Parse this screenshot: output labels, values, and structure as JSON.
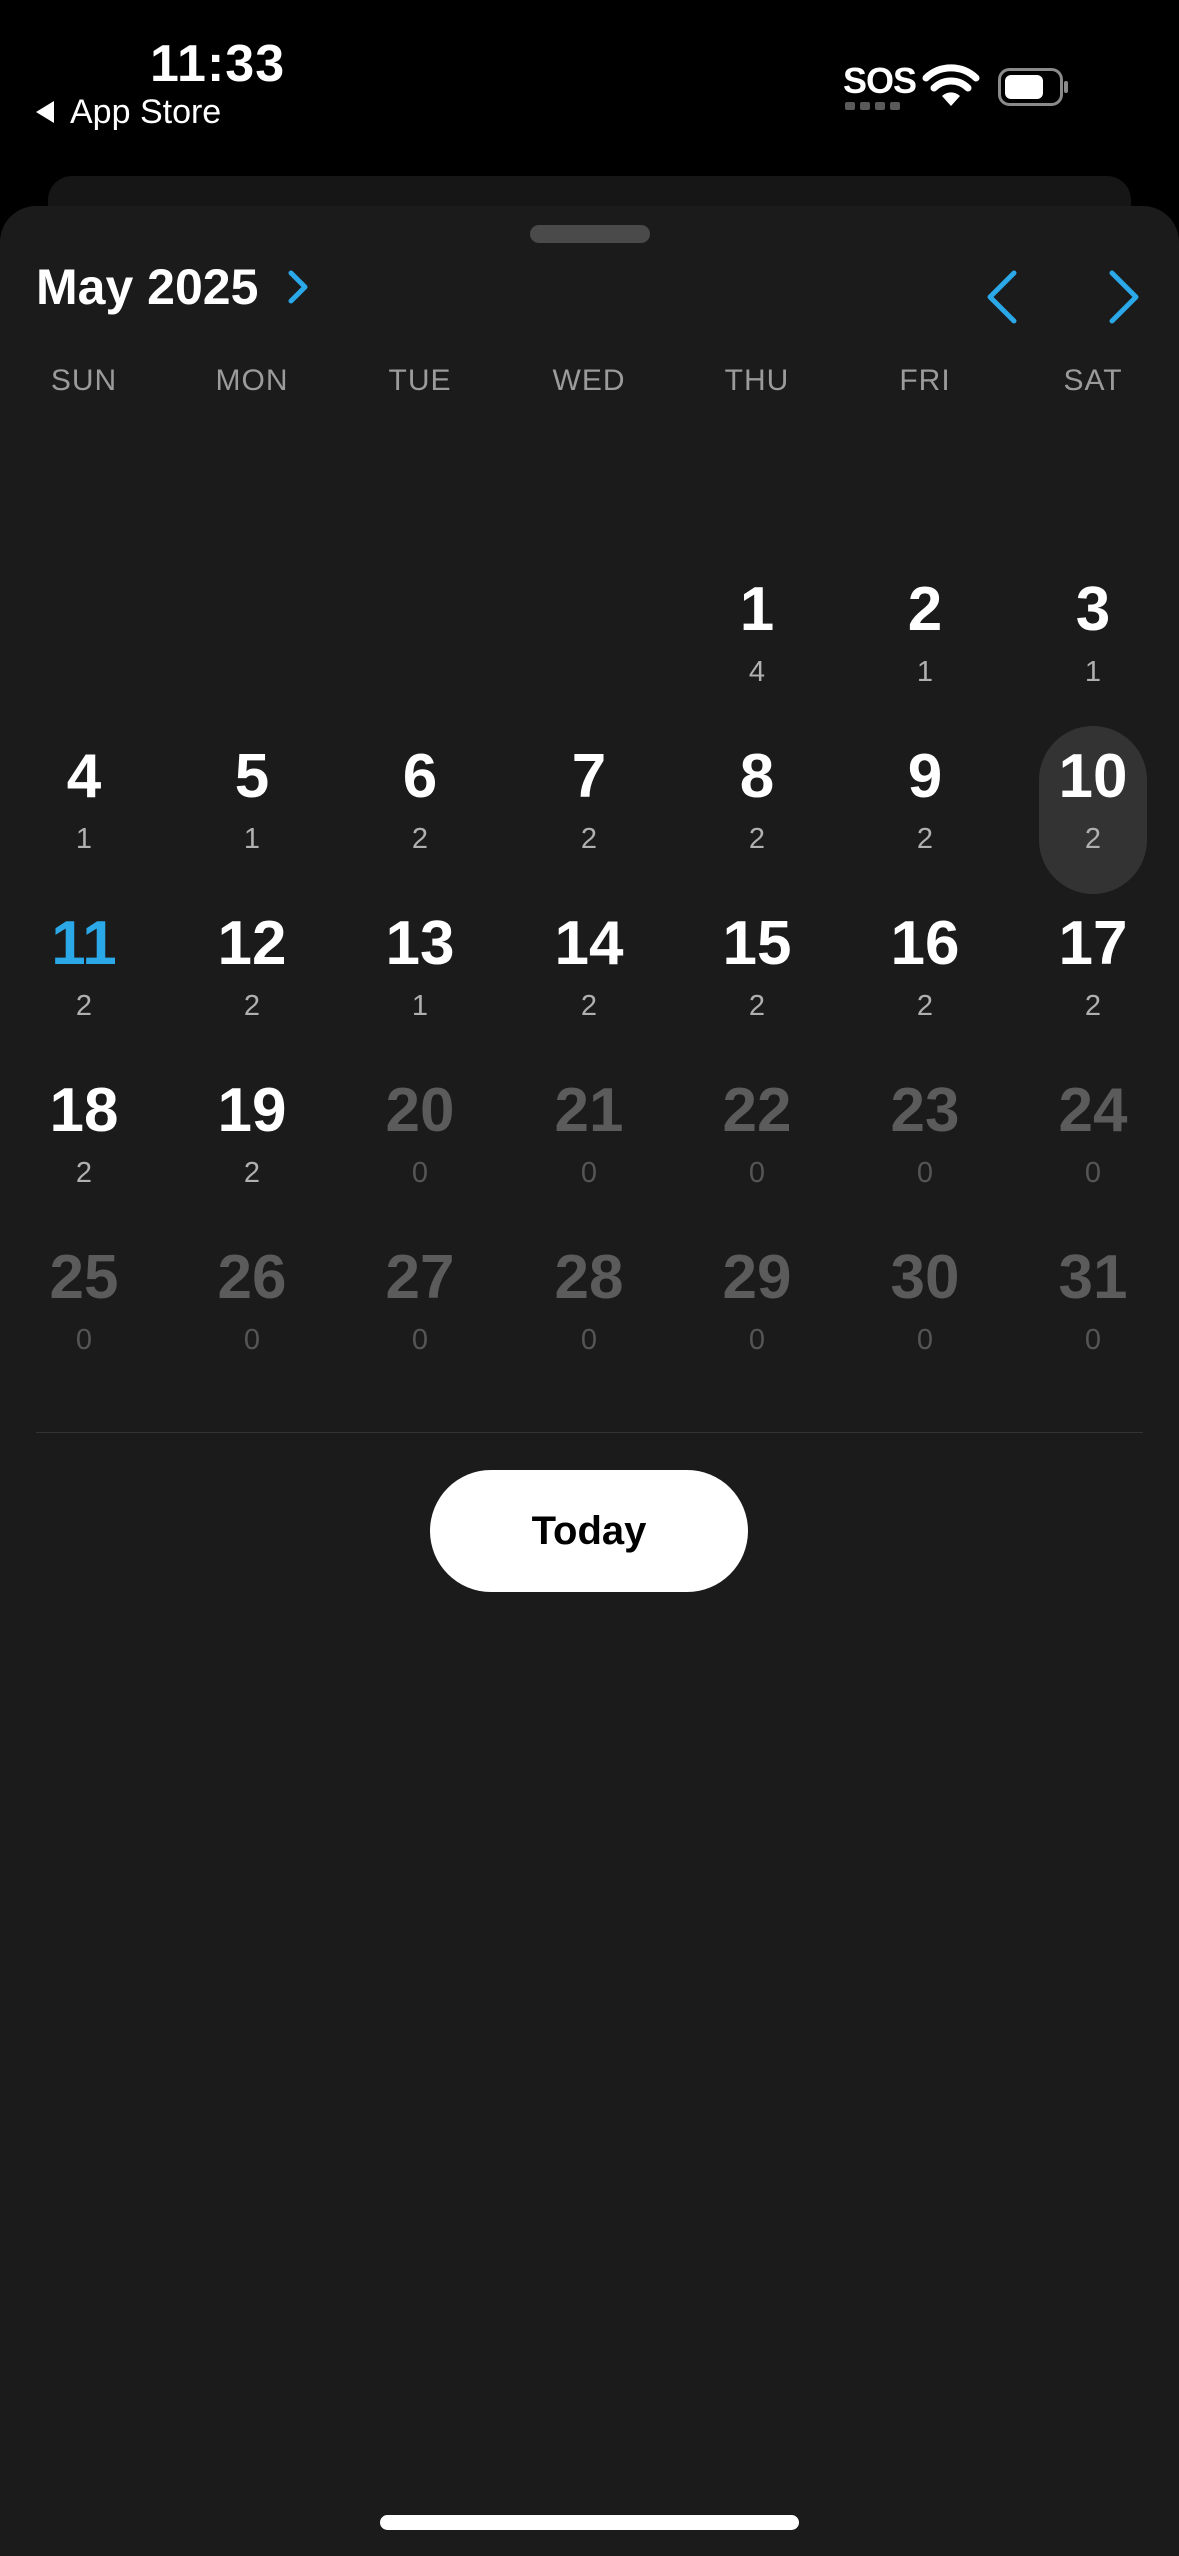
{
  "status_bar": {
    "time": "11:33",
    "back_label": "App Store",
    "sos": "SOS"
  },
  "calendar": {
    "month_label": "May 2025",
    "accent_color": "#2aa8e8",
    "weekdays": [
      "SUN",
      "MON",
      "TUE",
      "WED",
      "THU",
      "FRI",
      "SAT"
    ],
    "weeks": [
      [
        null,
        null,
        null,
        null,
        {
          "day": "1",
          "count": "4"
        },
        {
          "day": "2",
          "count": "1"
        },
        {
          "day": "3",
          "count": "1"
        }
      ],
      [
        {
          "day": "4",
          "count": "1"
        },
        {
          "day": "5",
          "count": "1"
        },
        {
          "day": "6",
          "count": "2"
        },
        {
          "day": "7",
          "count": "2"
        },
        {
          "day": "8",
          "count": "2"
        },
        {
          "day": "9",
          "count": "2"
        },
        {
          "day": "10",
          "count": "2",
          "state": "selected"
        }
      ],
      [
        {
          "day": "11",
          "count": "2",
          "state": "today"
        },
        {
          "day": "12",
          "count": "2"
        },
        {
          "day": "13",
          "count": "1"
        },
        {
          "day": "14",
          "count": "2"
        },
        {
          "day": "15",
          "count": "2"
        },
        {
          "day": "16",
          "count": "2"
        },
        {
          "day": "17",
          "count": "2"
        }
      ],
      [
        {
          "day": "18",
          "count": "2"
        },
        {
          "day": "19",
          "count": "2"
        },
        {
          "day": "20",
          "count": "0",
          "state": "future"
        },
        {
          "day": "21",
          "count": "0",
          "state": "future"
        },
        {
          "day": "22",
          "count": "0",
          "state": "future"
        },
        {
          "day": "23",
          "count": "0",
          "state": "future"
        },
        {
          "day": "24",
          "count": "0",
          "state": "future"
        }
      ],
      [
        {
          "day": "25",
          "count": "0",
          "state": "future"
        },
        {
          "day": "26",
          "count": "0",
          "state": "future"
        },
        {
          "day": "27",
          "count": "0",
          "state": "future"
        },
        {
          "day": "28",
          "count": "0",
          "state": "future"
        },
        {
          "day": "29",
          "count": "0",
          "state": "future"
        },
        {
          "day": "30",
          "count": "0",
          "state": "future"
        },
        {
          "day": "31",
          "count": "0",
          "state": "future"
        }
      ]
    ],
    "today_button": "Today"
  },
  "icons": {
    "month_expand": "chevron-right-icon",
    "prev_month": "chevron-left-icon",
    "next_month": "chevron-right-icon"
  }
}
